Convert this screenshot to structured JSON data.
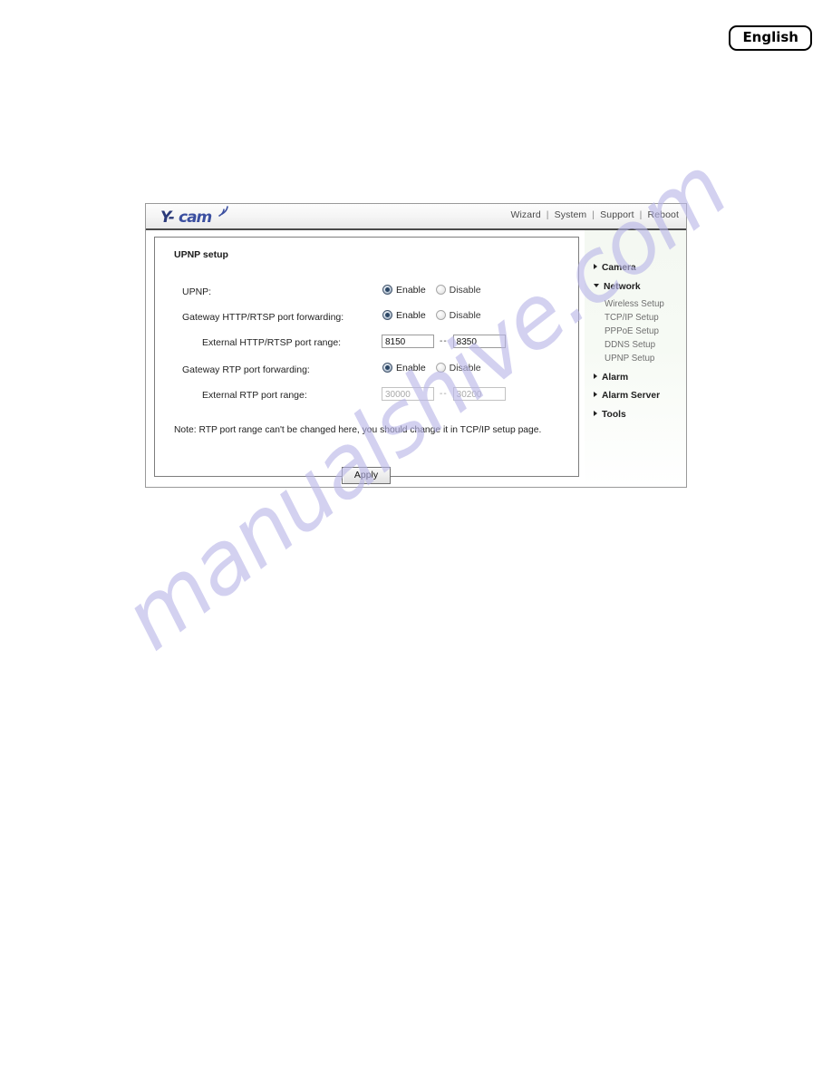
{
  "page": {
    "language_badge": "English"
  },
  "device": {
    "logo_text": "Y-cam",
    "logo_icon": "wireless-signal-icon",
    "top_nav": [
      {
        "label": "Wizard"
      },
      {
        "label": "System"
      },
      {
        "label": "Support"
      },
      {
        "label": "Reboot"
      }
    ],
    "nav_separator": "|",
    "panel": {
      "title": "UPNP setup",
      "rows": [
        {
          "label": "UPNP:",
          "indent": 1,
          "control": "radio",
          "options": [
            {
              "label": "Enable",
              "selected": true
            },
            {
              "label": "Disable",
              "selected": false
            }
          ]
        },
        {
          "label": "Gateway HTTP/RTSP port forwarding:",
          "indent": 1,
          "control": "radio",
          "options": [
            {
              "label": "Enable",
              "selected": true
            },
            {
              "label": "Disable",
              "selected": false
            }
          ]
        },
        {
          "label": "External HTTP/RTSP port range:",
          "indent": 2,
          "control": "range",
          "from_value": "8150",
          "to_value": "8350",
          "separator": "--",
          "disabled": false
        },
        {
          "label": "Gateway RTP port forwarding:",
          "indent": 1,
          "control": "radio",
          "options": [
            {
              "label": "Enable",
              "selected": true
            },
            {
              "label": "Disable",
              "selected": false
            }
          ]
        },
        {
          "label": "External RTP port range:",
          "indent": 2,
          "control": "range",
          "from_value": "30000",
          "to_value": "30200",
          "separator": "--",
          "disabled": true
        }
      ],
      "note": "Note: RTP port range can't be changed here, you should change it in TCP/IP setup page.",
      "apply_label": "Apply"
    },
    "sidebar": {
      "groups": [
        {
          "label": "Camera",
          "expanded": false,
          "icon": "chevron-right-icon",
          "items": []
        },
        {
          "label": "Network",
          "expanded": true,
          "icon": "chevron-down-icon",
          "items": [
            {
              "label": "Wireless Setup"
            },
            {
              "label": "TCP/IP Setup"
            },
            {
              "label": "PPPoE Setup"
            },
            {
              "label": "DDNS Setup"
            },
            {
              "label": "UPNP Setup"
            }
          ]
        },
        {
          "label": "Alarm",
          "expanded": false,
          "icon": "chevron-right-icon",
          "items": []
        },
        {
          "label": "Alarm Server",
          "expanded": false,
          "icon": "chevron-right-icon",
          "items": []
        },
        {
          "label": "Tools",
          "expanded": false,
          "icon": "chevron-right-icon",
          "items": []
        }
      ]
    }
  },
  "watermark": {
    "text": "manualshive.com",
    "color": "#b9b6e8"
  }
}
